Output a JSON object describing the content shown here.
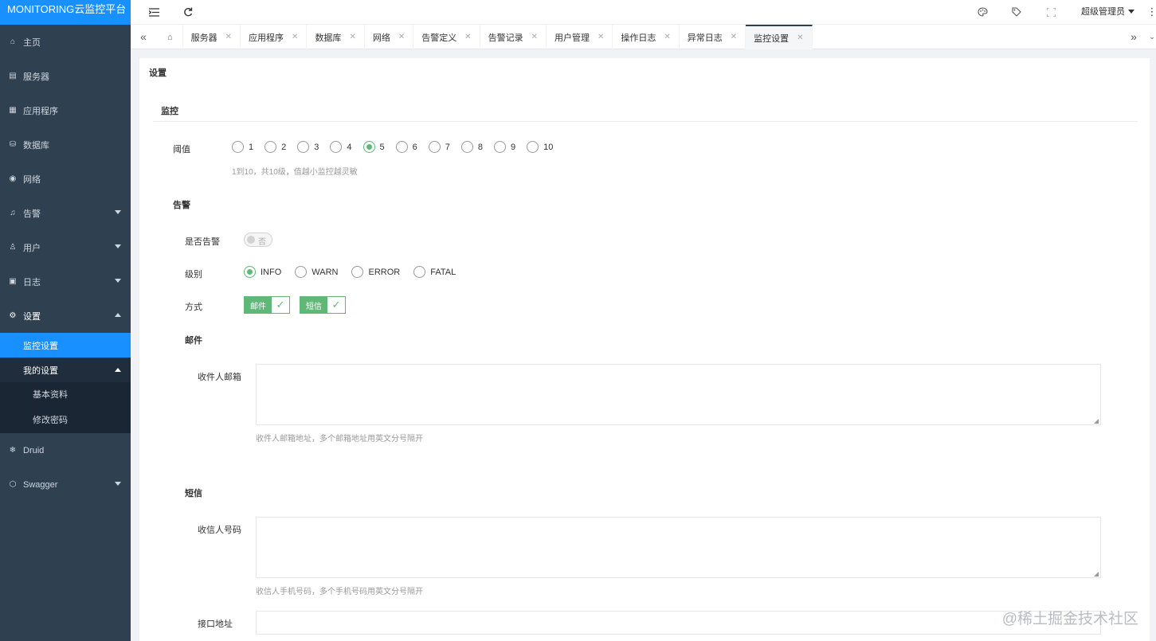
{
  "brand": "MONITORING云监控平台",
  "sidebar": {
    "items": [
      {
        "label": "主页",
        "icon": "home-icon"
      },
      {
        "label": "服务器",
        "icon": "server-icon"
      },
      {
        "label": "应用程序",
        "icon": "apps-icon"
      },
      {
        "label": "数据库",
        "icon": "database-icon"
      },
      {
        "label": "网络",
        "icon": "network-icon"
      },
      {
        "label": "告警",
        "icon": "bell-icon"
      },
      {
        "label": "用户",
        "icon": "user-icon"
      },
      {
        "label": "日志",
        "icon": "log-icon"
      },
      {
        "label": "设置",
        "icon": "gear-icon"
      },
      {
        "label": "Druid",
        "icon": "snowflake-icon"
      },
      {
        "label": "Swagger",
        "icon": "cube-icon"
      }
    ],
    "settings_sub": {
      "monitor_settings": "监控设置",
      "my_settings": "我的设置",
      "my_settings_items": [
        "基本资料",
        "修改密码"
      ]
    }
  },
  "topbar": {
    "user": "超级管理员"
  },
  "tabs": [
    {
      "label": "服务器"
    },
    {
      "label": "应用程序"
    },
    {
      "label": "数据库"
    },
    {
      "label": "网络"
    },
    {
      "label": "告警定义"
    },
    {
      "label": "告警记录"
    },
    {
      "label": "用户管理"
    },
    {
      "label": "操作日志"
    },
    {
      "label": "异常日志"
    },
    {
      "label": "监控设置"
    }
  ],
  "page": {
    "title": "设置",
    "monitor": {
      "section": "监控",
      "threshold_label": "阈值",
      "threshold_options": [
        "1",
        "2",
        "3",
        "4",
        "5",
        "6",
        "7",
        "8",
        "9",
        "10"
      ],
      "threshold_selected": "5",
      "threshold_hint": "1到10，共10级，值越小监控越灵敏"
    },
    "alarm": {
      "section": "告警",
      "enabled_label": "是否告警",
      "enabled_text": "否",
      "level_label": "级别",
      "level_options": [
        "INFO",
        "WARN",
        "ERROR",
        "FATAL"
      ],
      "level_selected": "INFO",
      "method_label": "方式",
      "method_mail": "邮件",
      "method_sms": "短信"
    },
    "mail": {
      "section": "邮件",
      "recipients_label": "收件人邮箱",
      "recipients_hint": "收件人邮箱地址，多个邮箱地址用英文分号隔开"
    },
    "sms": {
      "section": "短信",
      "recipients_label": "收信人号码",
      "recipients_hint": "收信人手机号码，多个手机号码用英文分号隔开",
      "api_label": "接口地址"
    }
  },
  "watermark": "@稀土掘金技术社区"
}
